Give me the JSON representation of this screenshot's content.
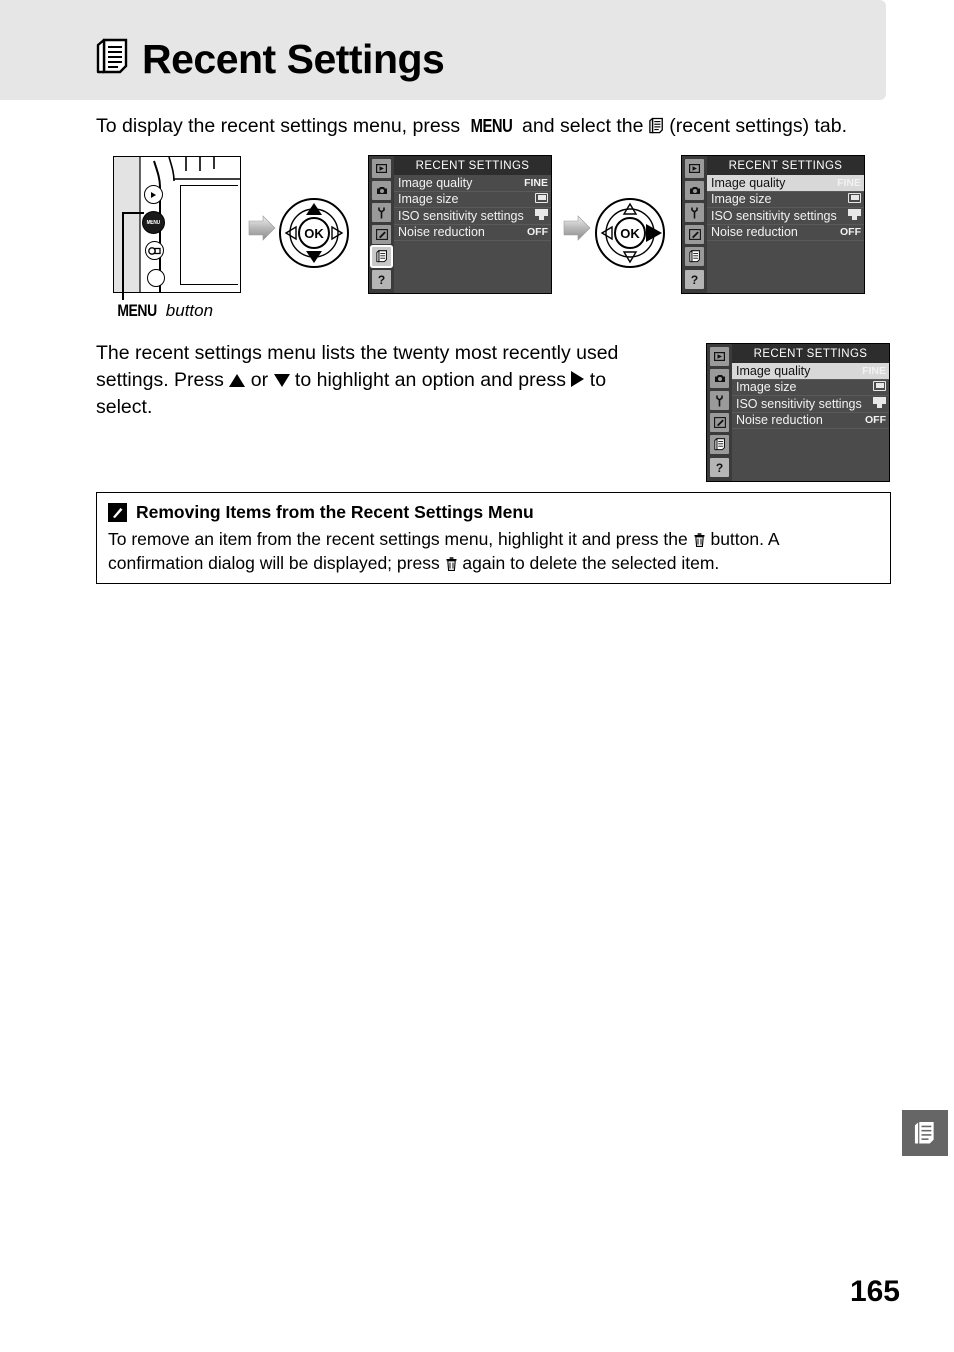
{
  "header": {
    "icon": "recent-settings-doc-icon",
    "title": "Recent Settings"
  },
  "intro": {
    "part1": "To display the recent settings menu, press ",
    "menu_button": "MENU",
    "part2": " and select the ",
    "icon": "recent-settings-doc-icon",
    "part3": " (recent settings) tab."
  },
  "figure": {
    "camera_caption_button": "MENU",
    "camera_caption_word": "button",
    "arrow1": "right-chevron-icon",
    "arrow2": "right-chevron-icon",
    "multiselector_ok": "OK",
    "screens": [
      {
        "name": "lcd-screen-1",
        "title": "RECENT SETTINGS",
        "highlight_index": -1,
        "sidebar": [
          "playback-icon",
          "shooting-menu-icon",
          "setup-wrench-icon",
          "custom-pencil-icon",
          "recent-settings-doc-icon",
          "help-icon"
        ],
        "selected_sidebar": 4,
        "rows": [
          {
            "label": "Image quality",
            "value": "FINE",
            "value_type": "text"
          },
          {
            "label": "Image size",
            "value": "",
            "value_type": "image-size-icon"
          },
          {
            "label": "ISO sensitivity settings",
            "value": "",
            "value_type": "iso-icon"
          },
          {
            "label": "Noise reduction",
            "value": "OFF",
            "value_type": "text"
          }
        ]
      },
      {
        "name": "lcd-screen-2",
        "title": "RECENT SETTINGS",
        "highlight_index": 0,
        "sidebar": [
          "playback-icon",
          "shooting-menu-icon",
          "setup-wrench-icon",
          "custom-pencil-icon",
          "recent-settings-doc-icon",
          "help-icon"
        ],
        "selected_sidebar": -1,
        "rows": [
          {
            "label": "Image quality",
            "value": "FINE",
            "value_type": "text"
          },
          {
            "label": "Image size",
            "value": "",
            "value_type": "image-size-icon"
          },
          {
            "label": "ISO sensitivity settings",
            "value": "",
            "value_type": "iso-icon"
          },
          {
            "label": "Noise reduction",
            "value": "OFF",
            "value_type": "text"
          }
        ]
      },
      {
        "name": "lcd-screen-3",
        "title": "RECENT SETTINGS",
        "highlight_index": 0,
        "sidebar": [
          "playback-icon",
          "shooting-menu-icon",
          "setup-wrench-icon",
          "custom-pencil-icon",
          "recent-settings-doc-icon",
          "help-icon"
        ],
        "selected_sidebar": -1,
        "rows": [
          {
            "label": "Image quality",
            "value": "FINE",
            "value_type": "text"
          },
          {
            "label": "Image size",
            "value": "",
            "value_type": "image-size-icon"
          },
          {
            "label": "ISO sensitivity settings",
            "value": "",
            "value_type": "iso-icon"
          },
          {
            "label": "Noise reduction",
            "value": "OFF",
            "value_type": "text"
          }
        ]
      }
    ]
  },
  "body": {
    "line1": "The recent settings menu lists the twenty most recently used",
    "seg1": "settings.  Press ",
    "up_arrow": "up-triangle-icon",
    "seg2": " or ",
    "down_arrow": "down-triangle-icon",
    "seg3": " to highlight an option and press ",
    "right_arrow": "right-triangle-icon",
    "seg4": " to",
    "line3": "select."
  },
  "note": {
    "icon": "pencil-note-icon",
    "heading": "Removing Items from the Recent Settings Menu",
    "text_a": "To remove an item from the recent settings menu, highlight it and press the ",
    "trash1": "trash-icon",
    "text_b": " button.  A",
    "text_c": "confirmation dialog will be displayed; press ",
    "trash2": "trash-icon",
    "text_d": " again to delete the selected item."
  },
  "footer": {
    "side_tab_icon": "recent-settings-doc-icon",
    "page_number": "165"
  },
  "colors": {
    "header_band": "#e6e6e6",
    "lcd_bg": "#4b4b4b",
    "lcd_title_bg": "#2d2d2d",
    "lcd_sidebar": "#3b3b3b",
    "highlight_row": "#d8d8d8",
    "side_tab": "#666666"
  }
}
